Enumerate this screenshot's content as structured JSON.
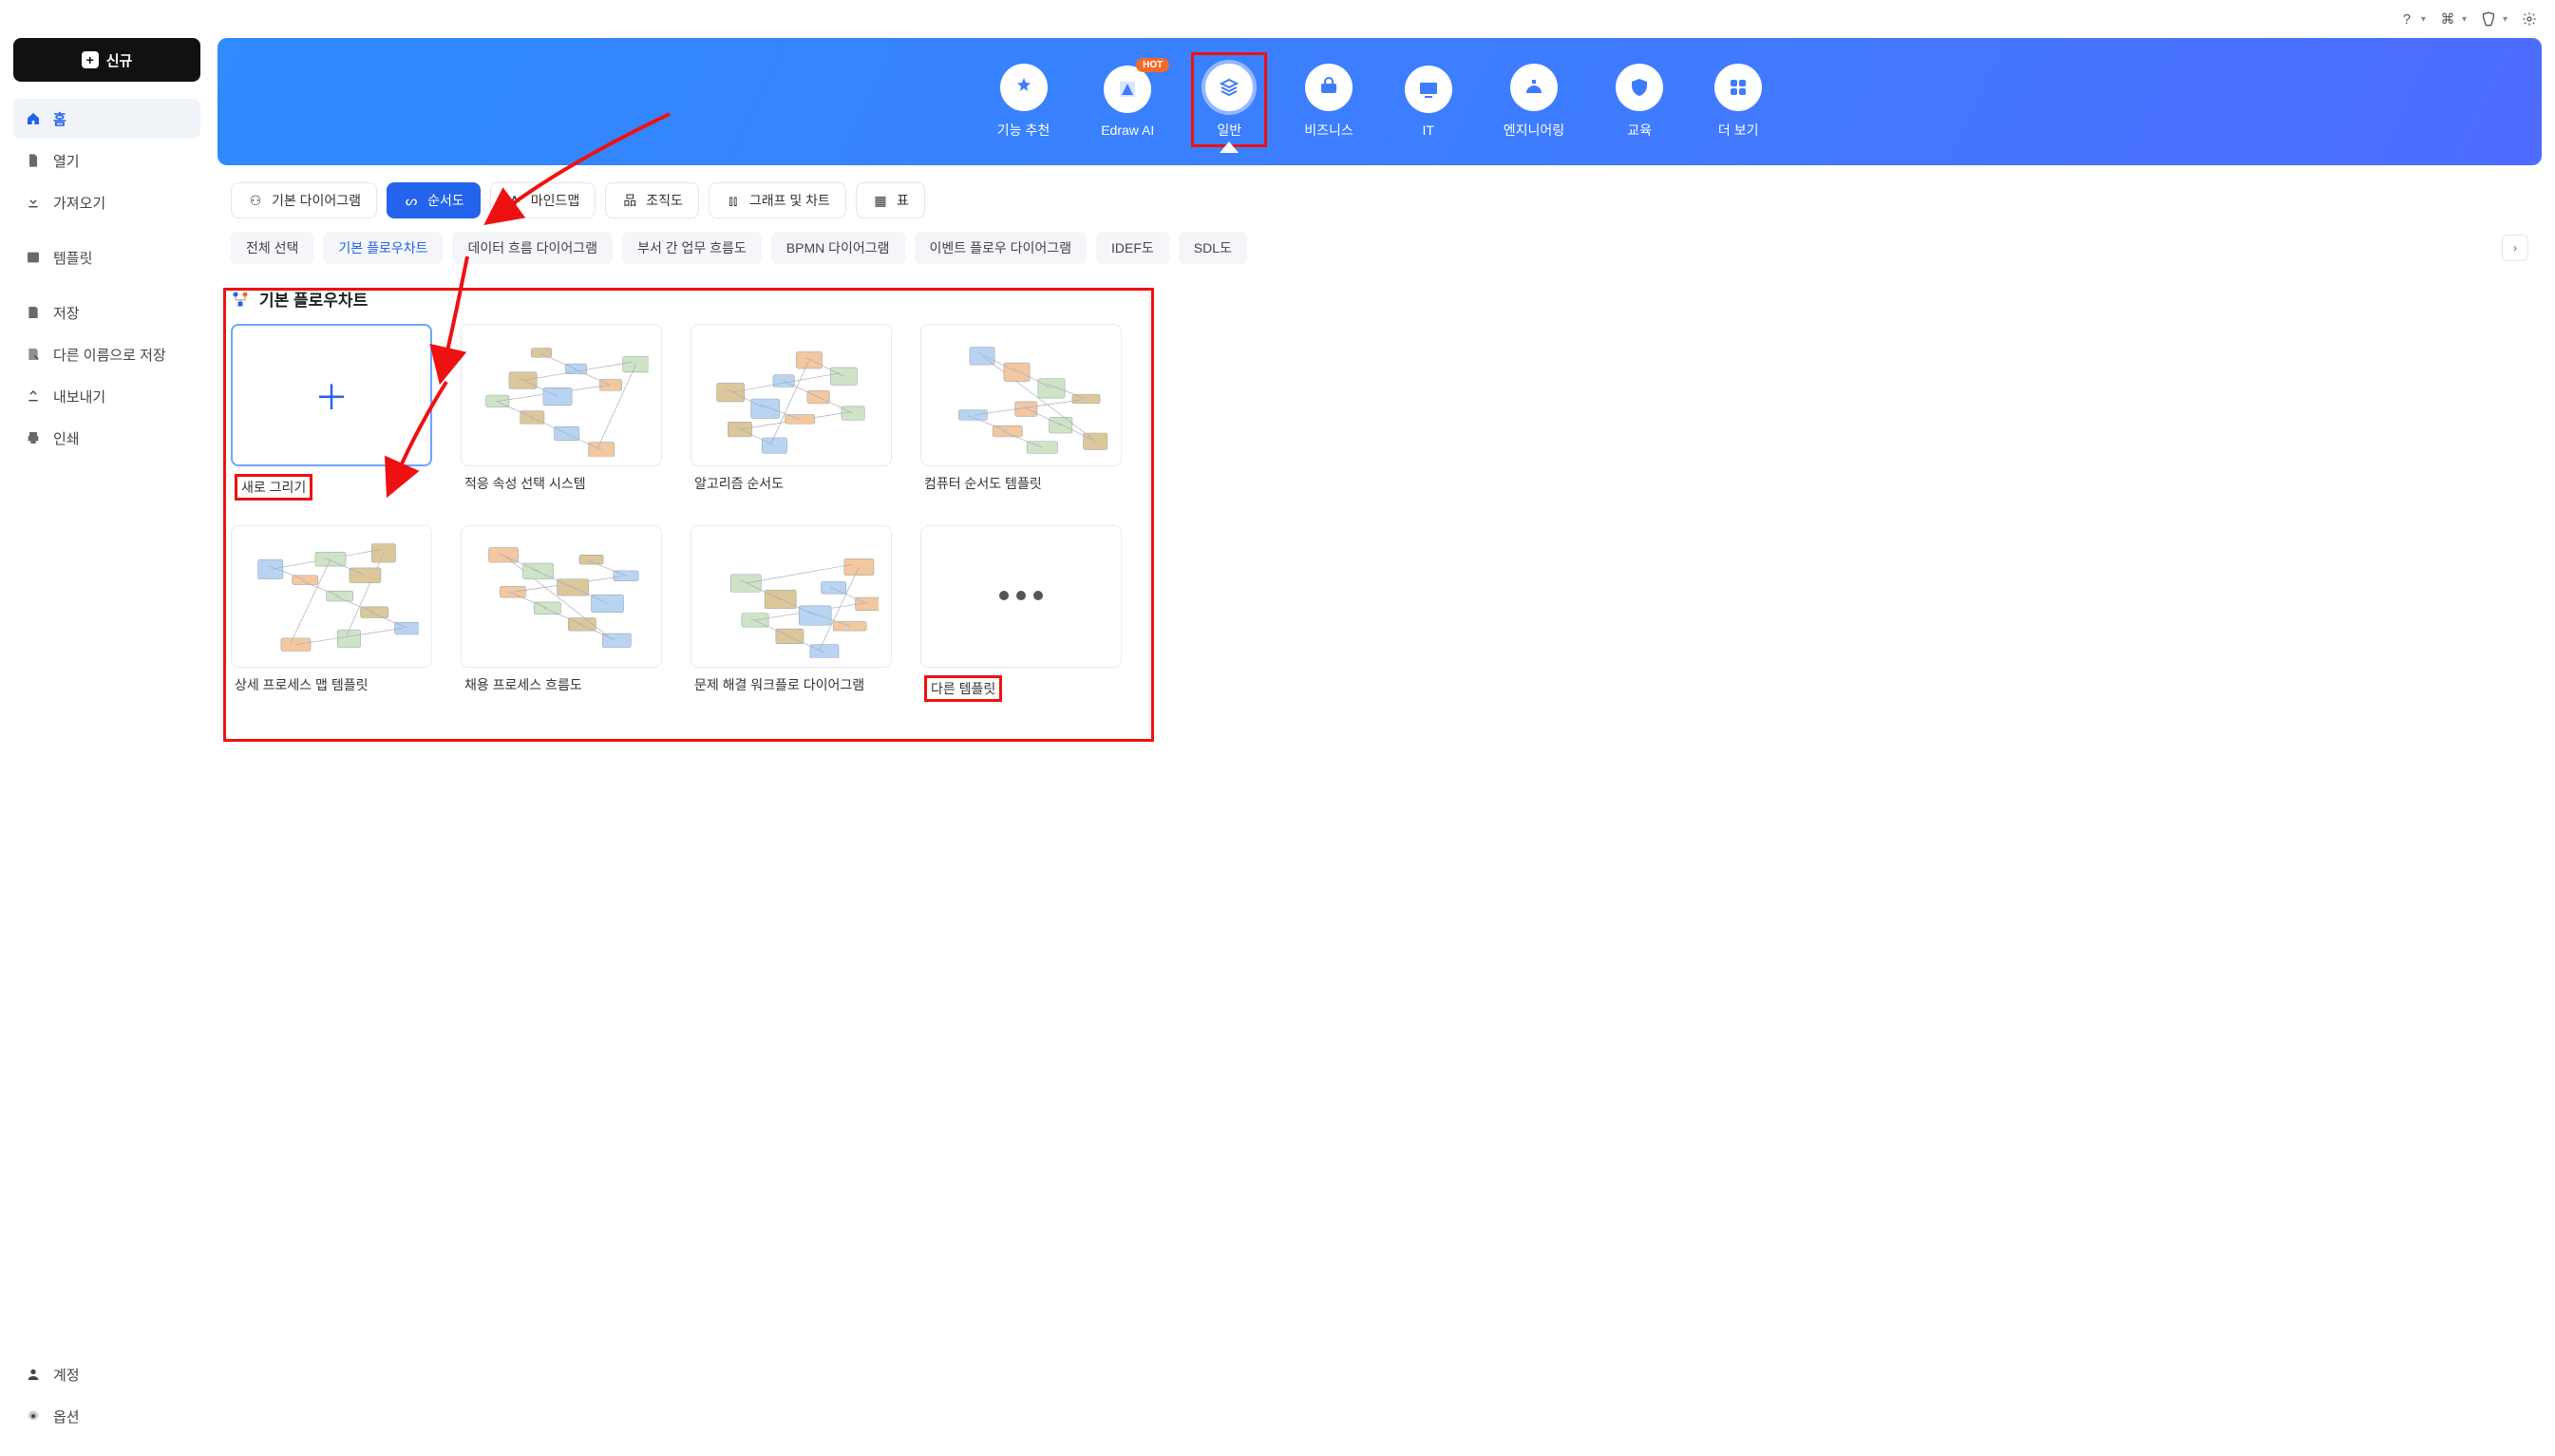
{
  "topbar": {
    "icons": [
      "help",
      "apps",
      "shirt",
      "gear"
    ]
  },
  "new_button": "신규",
  "nav": {
    "home": "홈",
    "open": "열기",
    "import": "가져오기",
    "templates": "템플릿",
    "save": "저장",
    "save_as": "다른 이름으로 저장",
    "export": "내보내기",
    "print": "인쇄",
    "account": "계정",
    "options": "옵션"
  },
  "hero": {
    "items": [
      {
        "label": "기능 추천"
      },
      {
        "label": "Edraw AI",
        "hot": "HOT"
      },
      {
        "label": "일반",
        "selected": true
      },
      {
        "label": "비즈니스"
      },
      {
        "label": "IT"
      },
      {
        "label": "엔지니어링"
      },
      {
        "label": "교육"
      },
      {
        "label": "더 보기"
      }
    ]
  },
  "tabs": [
    {
      "label": "기본 다이어그램"
    },
    {
      "label": "순서도",
      "active": true
    },
    {
      "label": "마인드맵"
    },
    {
      "label": "조직도"
    },
    {
      "label": "그래프 및 차트"
    },
    {
      "label": "표"
    }
  ],
  "chips": [
    {
      "label": "전체 선택"
    },
    {
      "label": "기본 플로우차트",
      "active": true
    },
    {
      "label": "데이터 흐름 다이어그램"
    },
    {
      "label": "부서 간 업무 흐름도"
    },
    {
      "label": "BPMN 다이어그램"
    },
    {
      "label": "이벤트 플로우 다이어그램"
    },
    {
      "label": "IDEF도"
    },
    {
      "label": "SDL도"
    }
  ],
  "section_title": "기본 플로우차트",
  "cards": [
    {
      "label": "새로 그리기",
      "blank": true,
      "highlight_label": true
    },
    {
      "label": "적응 속성 선택 시스템"
    },
    {
      "label": "알고리즘 순서도"
    },
    {
      "label": "컴퓨터 순서도 템플릿"
    },
    {
      "label": "상세 프로세스 맵 템플릿"
    },
    {
      "label": "채용 프로세스 흐름도"
    },
    {
      "label": "문제 해결 워크플로 다이어그램"
    },
    {
      "label": "다른 템플릿",
      "more": true,
      "highlight_label": true
    }
  ]
}
